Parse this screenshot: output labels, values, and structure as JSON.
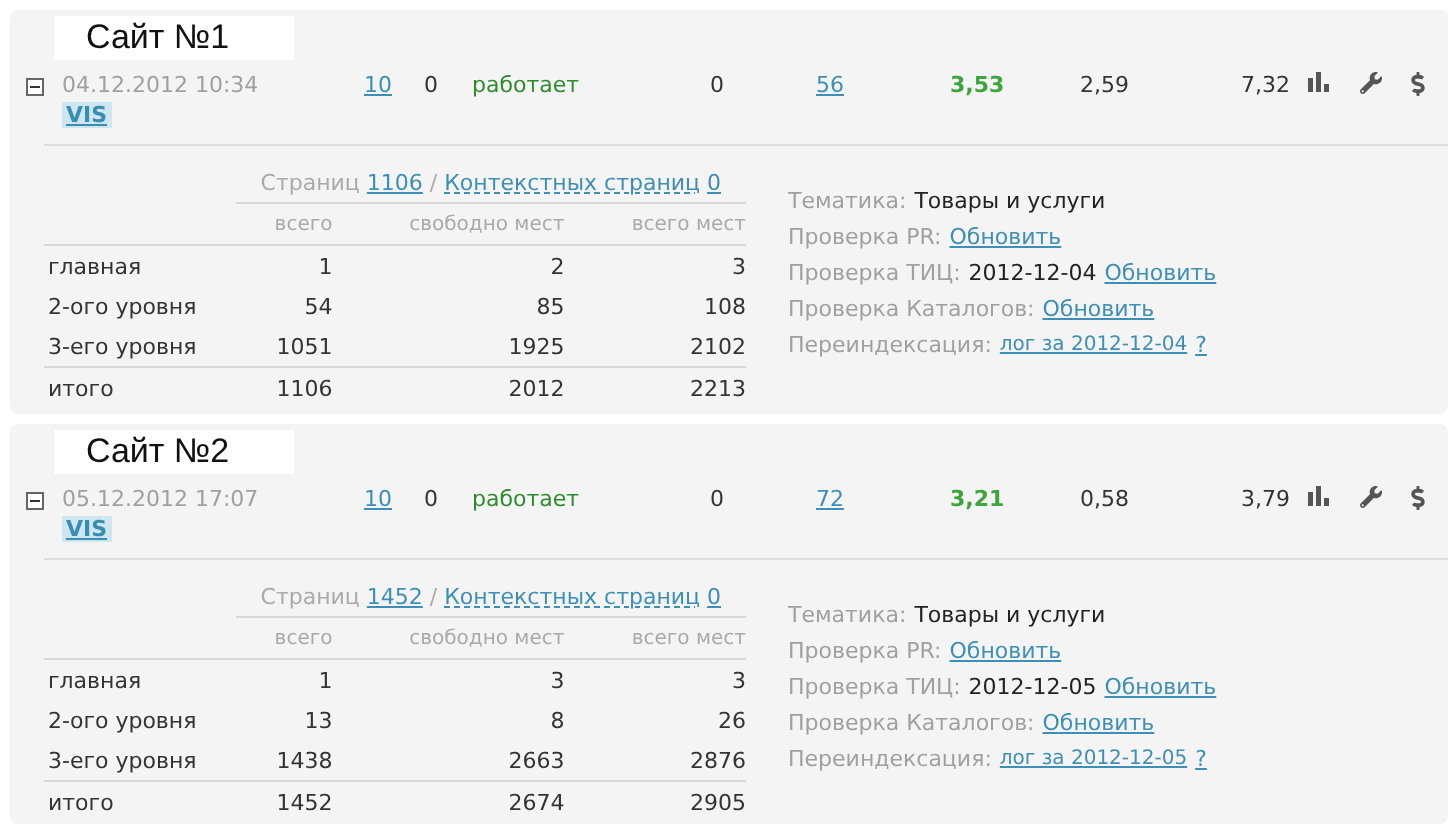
{
  "sites": [
    {
      "title": "Сайт №1",
      "date": "04.12.2012 10:34",
      "tag": "VIS",
      "expanded": true,
      "cells": [
        {
          "kind": "link",
          "text": "10"
        },
        {
          "kind": "plain",
          "text": "0"
        },
        {
          "kind": "status",
          "text": "работает"
        },
        {
          "kind": "plain",
          "text": "0"
        },
        {
          "kind": "link",
          "text": "56"
        },
        {
          "kind": "score",
          "text": "3,53"
        },
        {
          "kind": "plain",
          "text": "2,59"
        },
        {
          "kind": "plain",
          "text": "7,32"
        }
      ],
      "pages": {
        "label": "Страниц",
        "count": "1106",
        "separator": "/",
        "context_label": "Контекстных страниц",
        "context_count": "0"
      },
      "columns": [
        "всего",
        "свободно мест",
        "всего мест"
      ],
      "rows": [
        {
          "kind": "row",
          "label": "главная",
          "values": [
            "1",
            "2",
            "3"
          ]
        },
        {
          "kind": "row",
          "label": "2-ого уровня",
          "values": [
            "54",
            "85",
            "108"
          ]
        },
        {
          "kind": "row",
          "label": "3-его уровня",
          "values": [
            "1051",
            "1925",
            "2102"
          ]
        },
        {
          "kind": "total",
          "label": "итого",
          "values": [
            "1106",
            "2012",
            "2213"
          ]
        }
      ],
      "info": [
        {
          "label": "Тематика:",
          "value": "Товары и услуги"
        },
        {
          "label": "Проверка PR:",
          "links": [
            "Обновить"
          ]
        },
        {
          "label": "Проверка ТИЦ:",
          "value": "2012-12-04",
          "links": [
            "Обновить"
          ]
        },
        {
          "label": "Проверка Каталогов:",
          "links": [
            "Обновить"
          ]
        },
        {
          "label": "Переиндексация:",
          "links": [
            "лог за 2012-12-04",
            "?"
          ]
        }
      ]
    },
    {
      "title": "Сайт №2",
      "date": "05.12.2012 17:07",
      "tag": "VIS",
      "expanded": true,
      "cells": [
        {
          "kind": "link",
          "text": "10"
        },
        {
          "kind": "plain",
          "text": "0"
        },
        {
          "kind": "status",
          "text": "работает"
        },
        {
          "kind": "plain",
          "text": "0"
        },
        {
          "kind": "link",
          "text": "72"
        },
        {
          "kind": "score",
          "text": "3,21"
        },
        {
          "kind": "plain",
          "text": "0,58"
        },
        {
          "kind": "plain",
          "text": "3,79"
        }
      ],
      "pages": {
        "label": "Страниц",
        "count": "1452",
        "separator": "/",
        "context_label": "Контекстных страниц",
        "context_count": "0"
      },
      "columns": [
        "всего",
        "свободно мест",
        "всего мест"
      ],
      "rows": [
        {
          "kind": "row",
          "label": "главная",
          "values": [
            "1",
            "3",
            "3"
          ]
        },
        {
          "kind": "row",
          "label": "2-ого уровня",
          "values": [
            "13",
            "8",
            "26"
          ]
        },
        {
          "kind": "row",
          "label": "3-его уровня",
          "values": [
            "1438",
            "2663",
            "2876"
          ]
        },
        {
          "kind": "total",
          "label": "итого",
          "values": [
            "1452",
            "2674",
            "2905"
          ]
        }
      ],
      "info": [
        {
          "label": "Тематика:",
          "value": "Товары и услуги"
        },
        {
          "label": "Проверка PR:",
          "links": [
            "Обновить"
          ]
        },
        {
          "label": "Проверка ТИЦ:",
          "value": "2012-12-05",
          "links": [
            "Обновить"
          ]
        },
        {
          "label": "Проверка Каталогов:",
          "links": [
            "Обновить"
          ]
        },
        {
          "label": "Переиндексация:",
          "links": [
            "лог за 2012-12-05",
            "?"
          ]
        }
      ]
    }
  ]
}
